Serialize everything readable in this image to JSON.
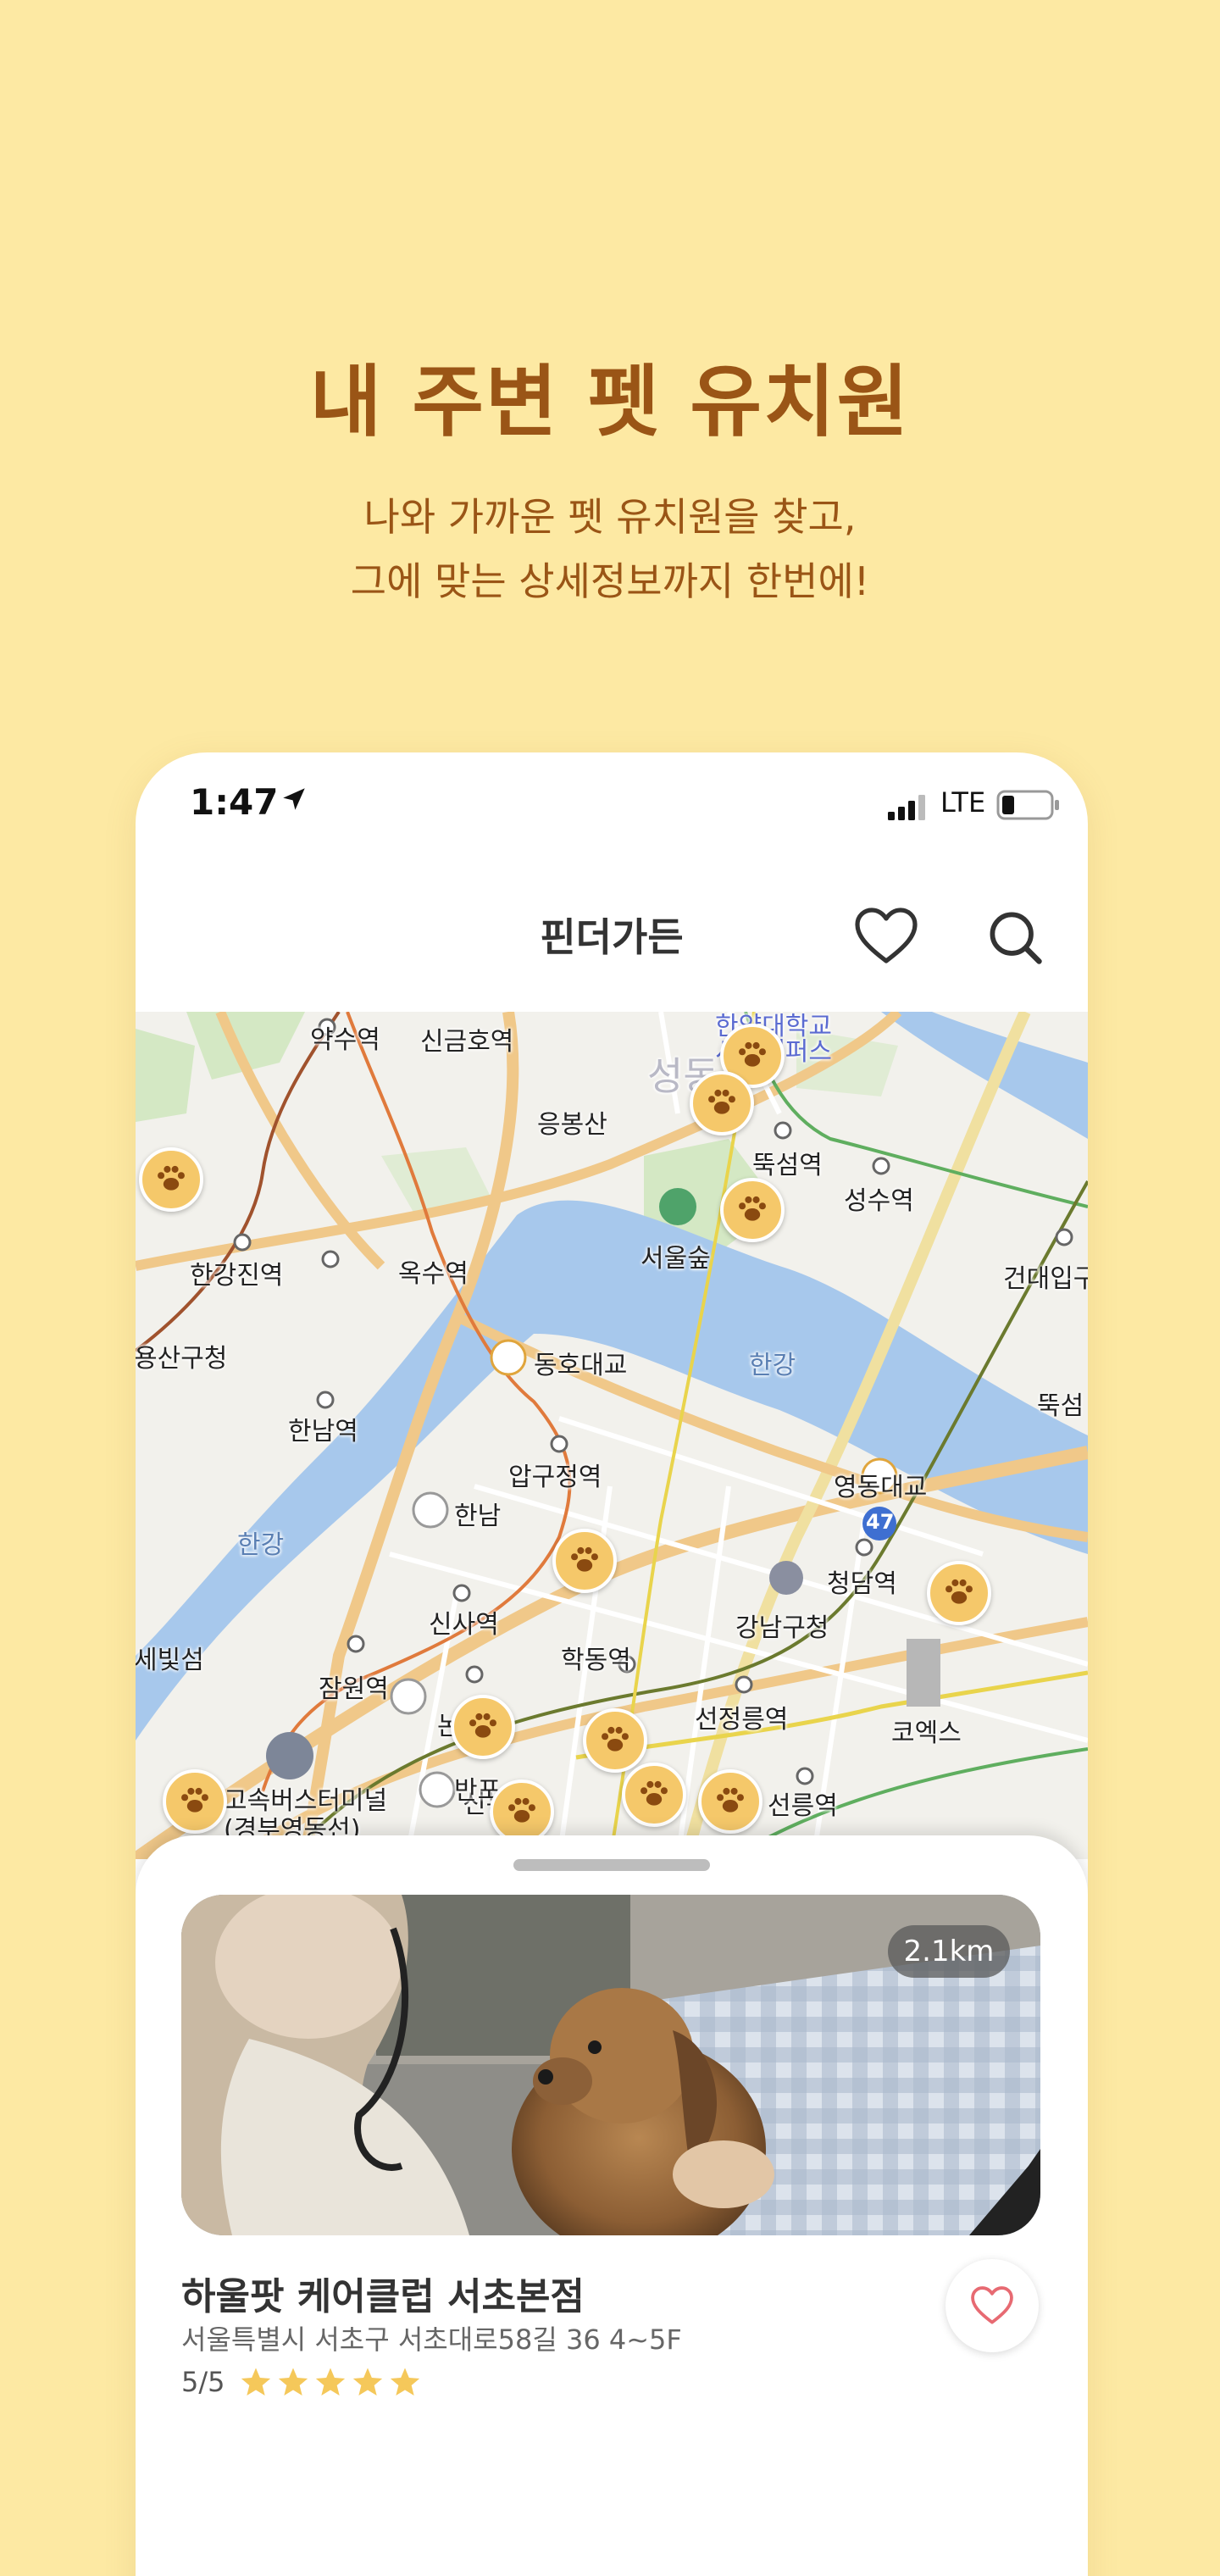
{
  "hero": {
    "title": "내 주변 펫 유치원",
    "subtitle_line1": "나와 가까운 펫 유치원을 찾고,",
    "subtitle_line2": "그에 맞는 상세정보까지 한번에!"
  },
  "status_bar": {
    "time": "1:47",
    "network": "LTE",
    "icons": [
      "location-arrow-icon",
      "signal-icon",
      "battery-icon"
    ]
  },
  "app_bar": {
    "title": "핀더가든",
    "icons": [
      "heart-icon",
      "search-icon"
    ]
  },
  "map": {
    "labels": {
      "yaksu": "약수역",
      "singeumho": "신금호역",
      "eungbongsan": "응봉산",
      "hanyang": "한양대학교",
      "seoul_campus": "서울캠퍼스",
      "seongdong": "성동",
      "ttukseom": "뚝섬역",
      "seongsu": "성수역",
      "hangangjin": "한강진역",
      "oksu": "옥수역",
      "seoulsup": "서울숲",
      "kondae": "건대입구",
      "yongsan": "용산구청",
      "dongho": "동호대교",
      "hangang_river1": "한강",
      "ttuk": "뚝섬",
      "hannam": "한남역",
      "apgujeong": "압구정역",
      "ic_hannam": "한남",
      "yeongdong": "영동대교",
      "hangang_river2": "한강",
      "cheongdam": "청담역",
      "gangnam_gu": "강남구청",
      "sebit": "세빛섬",
      "sinsa": "신사역",
      "hakdong": "학동역",
      "jamwon": "잠원역",
      "seonjeongneung": "선정릉역",
      "coex": "코엑스",
      "express_bus": "고속버스터미널",
      "gyeongbu": "(경부영동선)",
      "seolleung": "선릉역",
      "road_47": "47",
      "partial_sinnonhyeon": "신논현",
      "partial_nonhyeon": "논현",
      "partial_bangbae": "반포"
    },
    "zoom_in": "+",
    "zoom_out": "−"
  },
  "place": {
    "distance": "2.1km",
    "name": "하울팟 케어클럽 서초본점",
    "address": "서울특별시 서초구 서초대로58길 36 4~5F",
    "rating_text": "5/5",
    "rating_value": 5,
    "rating_max": 5
  },
  "colors": {
    "background": "#FDE9A3",
    "hero_text": "#9A5516",
    "paw_marker": "#F5C86A",
    "paw_icon": "#8A4A10",
    "star": "#F5C85A",
    "favorite_heart": "#E76A72",
    "river": "#A7C8EC"
  }
}
